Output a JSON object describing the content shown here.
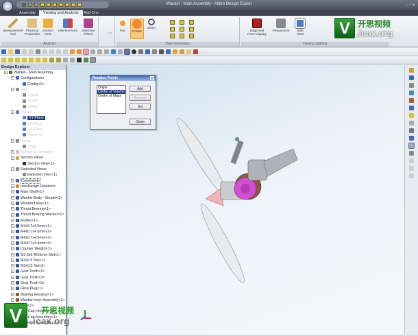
{
  "window": {
    "title": "Wankel - Main Assembly - Alibre Design Expert",
    "controls": "– ▫ ✕"
  },
  "tabs": [
    {
      "label": "Assembly"
    },
    {
      "label": "Viewing and Analysis"
    },
    {
      "label": "Add-Ons"
    }
  ],
  "ribbon": {
    "analysis": {
      "label": "Analysis",
      "buttons": [
        "Measurement Tool",
        "Physical Properties",
        "Section View",
        "Interferences",
        "Selection Filters"
      ],
      "fill_label": "Fill"
    },
    "view_orientation": {
      "label": "View Orientation",
      "buttons": [
        "Pan",
        "Rotate",
        "Zoom"
      ]
    },
    "viewing_options": {
      "label": "Viewing Options",
      "buttons": [
        "Edge and Face Display",
        "Perspective",
        "Split View"
      ]
    }
  },
  "explorer": {
    "title": "Design Explorer",
    "nodes": [
      {
        "label": "Wankel - Main Assembly",
        "level": 0,
        "icon": "#7a5a2a"
      },
      {
        "label": "Configurations",
        "level": 1,
        "icon": "#3a6ab8"
      },
      {
        "label": "Config<1>",
        "level": 2,
        "icon": "#3a6ab8"
      },
      {
        "label": "Axes",
        "level": 1,
        "icon": "#888",
        "dim": true
      },
      {
        "label": "X-Axis",
        "level": 2,
        "icon": "#888",
        "dim": true
      },
      {
        "label": "Y-Axis",
        "level": 2,
        "icon": "#888",
        "dim": true
      },
      {
        "label": "Z-Axis",
        "level": 2,
        "icon": "#888",
        "dim": true
      },
      {
        "label": "Planes",
        "level": 1,
        "icon": "#5a78c8",
        "dim": true
      },
      {
        "label": "XY-Plane",
        "level": 2,
        "icon": "#5a78c8",
        "sel": true
      },
      {
        "label": "YZ-Plane",
        "level": 2,
        "icon": "#5a78c8",
        "dim": true
      },
      {
        "label": "ZX-Plane",
        "level": 2,
        "icon": "#5a78c8",
        "dim": true
      },
      {
        "label": "Plane<1>",
        "level": 2,
        "icon": "#5a78c8",
        "dim": true
      },
      {
        "label": "Points",
        "level": 1,
        "icon": "#888",
        "dim": true
      },
      {
        "label": "Origin",
        "level": 2,
        "icon": "#888",
        "dim": true
      },
      {
        "label": "Reference Geometry",
        "level": 1,
        "icon": "#e6b0b0",
        "dim": true
      },
      {
        "label": "Section Views",
        "level": 1,
        "icon": "#d9a030"
      },
      {
        "label": "Section View<1>",
        "level": 2,
        "icon": "#333"
      },
      {
        "label": "Exploded Views",
        "level": 1,
        "icon": "#888"
      },
      {
        "label": "Exploded View (1)",
        "level": 2,
        "icon": "#888"
      },
      {
        "label": "Constraints",
        "level": 1,
        "icon": "#4a6a9a",
        "box": true
      },
      {
        "label": "InterDesign Relations",
        "level": 1,
        "icon": "#c89030"
      },
      {
        "label": "Main Shaft<1>",
        "level": 1,
        "icon": "#2c5aa0"
      },
      {
        "label": "Wankel Body - Simple<1>",
        "level": 1,
        "icon": "#2c5aa0"
      },
      {
        "label": "Woodruff Key<1>",
        "level": 1,
        "icon": "#2c5aa0"
      },
      {
        "label": "Thrust Bearing<1>",
        "level": 1,
        "icon": "#2c5aa0"
      },
      {
        "label": "Thrust Bearing Washer<1>",
        "level": 1,
        "icon": "#2c5aa0"
      },
      {
        "label": "Muffler<1>",
        "level": 1,
        "icon": "#2c5aa0"
      },
      {
        "label": "M4x0.7x4.5mm<1>",
        "level": 1,
        "icon": "#2c5aa0"
      },
      {
        "label": "M4x0.7x4.5mm<2>",
        "level": 1,
        "icon": "#2c5aa0"
      },
      {
        "label": "M4x0.7x4.5mm<3>",
        "level": 1,
        "icon": "#2c5aa0"
      },
      {
        "label": "M4x0.7x4.5mm<4>",
        "level": 1,
        "icon": "#2c5aa0"
      },
      {
        "label": "Counter Weight<1>",
        "level": 1,
        "icon": "#2c5aa0"
      },
      {
        "label": "M2.5x0.45x5mm-Slot<1>",
        "level": 1,
        "icon": "#2c5aa0"
      },
      {
        "label": "M3x0.5 Nut<1>",
        "level": 1,
        "icon": "#2c5aa0"
      },
      {
        "label": "M3x0.5 Nut<2>",
        "level": 1,
        "icon": "#2c5aa0"
      },
      {
        "label": "Gear Tooth<1>",
        "level": 1,
        "icon": "#2c5aa0"
      },
      {
        "label": "Gear Tooth<2>",
        "level": 1,
        "icon": "#2c5aa0"
      },
      {
        "label": "Gear Tooth<3>",
        "level": 1,
        "icon": "#2c5aa0"
      },
      {
        "label": "Glow Plug<1>",
        "level": 1,
        "icon": "#2c5aa0"
      },
      {
        "label": "Bearing Housing<1>",
        "level": 1,
        "icon": "#8a5a2a"
      },
      {
        "label": "Wankel Inner Assembly<1>",
        "level": 1,
        "icon": "#8a5a2a"
      },
      {
        "label": "Fuel<1>",
        "level": 1,
        "icon": "#8a5a2a"
      },
      {
        "label": "End Cap Housing<1>",
        "level": 1,
        "icon": "#8a5a2a"
      },
      {
        "label": "End Cap Assembly<1>",
        "level": 1,
        "icon": "#8a5a2a"
      },
      {
        "label": "Propeller Assembly<1>",
        "level": 1,
        "icon": "#8a5a2a"
      }
    ]
  },
  "dialog": {
    "title": "Rotation Points",
    "close_x": "x",
    "list": [
      "Origin",
      "Center of Volume",
      "Center of Mass"
    ],
    "selected": "Center of Volume",
    "buttons": {
      "add": "Add",
      "remove": "Remove",
      "set": "Set",
      "close": "Close"
    }
  },
  "watermark": {
    "v": "V",
    "cn": "开思视频",
    "site": ".icax.org"
  }
}
